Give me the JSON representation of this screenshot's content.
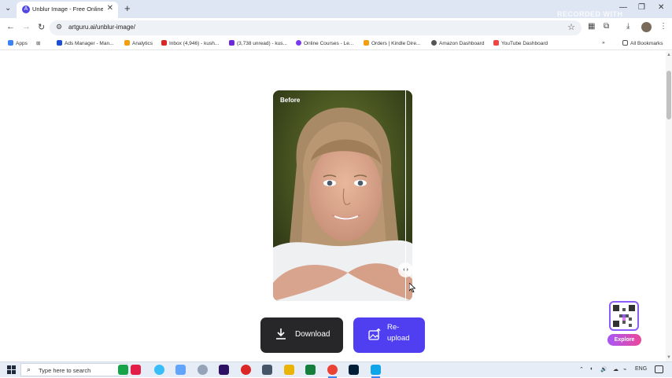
{
  "browser": {
    "tab_title": "Unblur Image - Free Online AI I",
    "url": "artguru.ai/unblur-image/",
    "watermark": "RECORDED WITH SCREENCAST"
  },
  "bookmarks": [
    {
      "label": "Apps",
      "icon": "apps-grid-icon"
    },
    {
      "label": "Ads Manager - Man...",
      "icon": "meta-icon"
    },
    {
      "label": "Analytics",
      "icon": "analytics-icon"
    },
    {
      "label": "Inbox (4,946) - kush...",
      "icon": "gmail-icon"
    },
    {
      "label": "(3,738 unread) - kus...",
      "icon": "yahoo-mail-icon"
    },
    {
      "label": "Online Courses - Le...",
      "icon": "udemy-icon"
    },
    {
      "label": "Orders | Kindle Dire...",
      "icon": "kdp-icon"
    },
    {
      "label": "Amazon Dashboard",
      "icon": "globe-icon"
    },
    {
      "label": "YouTube Dashboard",
      "icon": "youtube-icon"
    }
  ],
  "all_bookmarks_label": "All Bookmarks",
  "editor": {
    "before_label": "Before",
    "download_label": "Download",
    "reupload_label": "Re-upload"
  },
  "widget": {
    "explore_label": "Explore"
  },
  "taskbar": {
    "search_placeholder": "Type here to search",
    "language": "ENG"
  },
  "colors": {
    "accent": "#4f3ff0",
    "download_bg": "#27272a",
    "explore_gradient_start": "#a855f7",
    "explore_gradient_end": "#ec4899"
  }
}
